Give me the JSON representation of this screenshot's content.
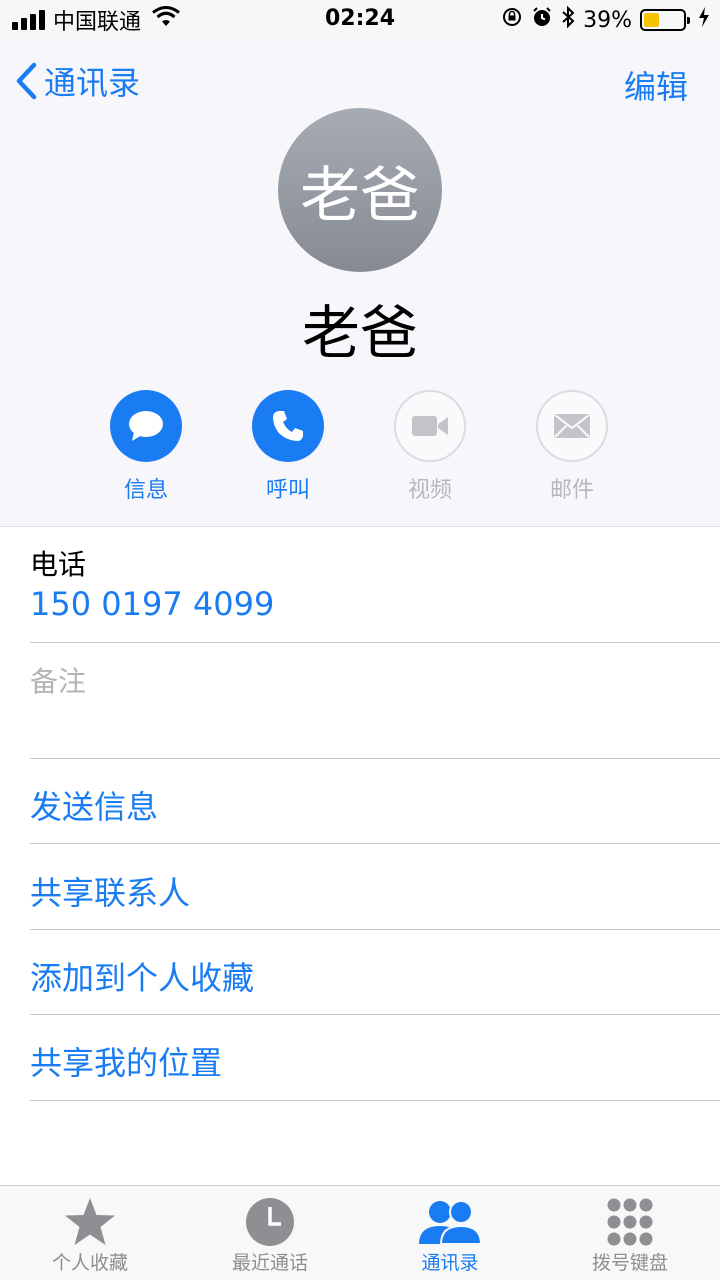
{
  "status_bar": {
    "carrier": "中国联通",
    "time": "02:24",
    "battery_percent": "39%",
    "battery_level": 0.39,
    "icons": [
      "signal-icon",
      "wifi-icon",
      "orientation-lock-icon",
      "alarm-icon",
      "bluetooth-icon",
      "battery-icon",
      "charging-icon"
    ]
  },
  "nav": {
    "back_label": "通讯录",
    "edit_label": "编辑"
  },
  "contact": {
    "avatar_text": "老爸",
    "name": "老爸"
  },
  "actions": [
    {
      "label": "信息",
      "icon": "message-icon",
      "enabled": true
    },
    {
      "label": "呼叫",
      "icon": "phone-icon",
      "enabled": true
    },
    {
      "label": "视频",
      "icon": "video-icon",
      "enabled": false
    },
    {
      "label": "邮件",
      "icon": "mail-icon",
      "enabled": false
    }
  ],
  "phone": {
    "label": "电话",
    "number": "150 0197 4099"
  },
  "notes": {
    "label": "备注"
  },
  "options": [
    "发送信息",
    "共享联系人",
    "添加到个人收藏",
    "共享我的位置"
  ],
  "tabs": [
    {
      "label": "个人收藏",
      "icon": "star-icon",
      "active": false
    },
    {
      "label": "最近通话",
      "icon": "clock-icon",
      "active": false
    },
    {
      "label": "通讯录",
      "icon": "contacts-icon",
      "active": true
    },
    {
      "label": "拨号键盘",
      "icon": "keypad-icon",
      "active": false
    }
  ],
  "colors": {
    "accent": "#1a7cf2",
    "battery": "#f5c400"
  }
}
